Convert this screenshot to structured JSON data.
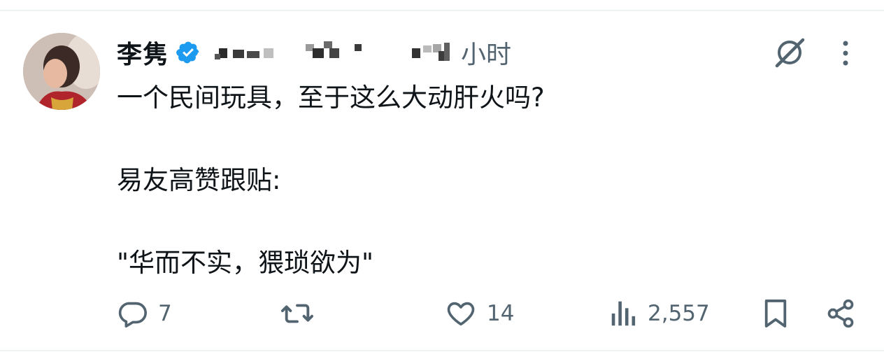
{
  "tweet": {
    "display_name": "李隽",
    "time_suffix": "小时",
    "text": "一个民间玩具，至于这么大动肝火吗?\n\n易友高赞跟贴:\n\n\"华而不实，猥琐欲为\""
  },
  "actions": {
    "reply_count": "7",
    "like_count": "14",
    "view_count": "2,557"
  },
  "colors": {
    "text": "#0f1419",
    "secondary": "#536471",
    "verified_blue": "#1d9bf0",
    "divider": "#eff3f4"
  },
  "icons": [
    "verified-badge-icon",
    "grok-icon",
    "more-icon",
    "reply-icon",
    "retweet-icon",
    "like-icon",
    "views-icon",
    "bookmark-icon",
    "share-icon"
  ]
}
